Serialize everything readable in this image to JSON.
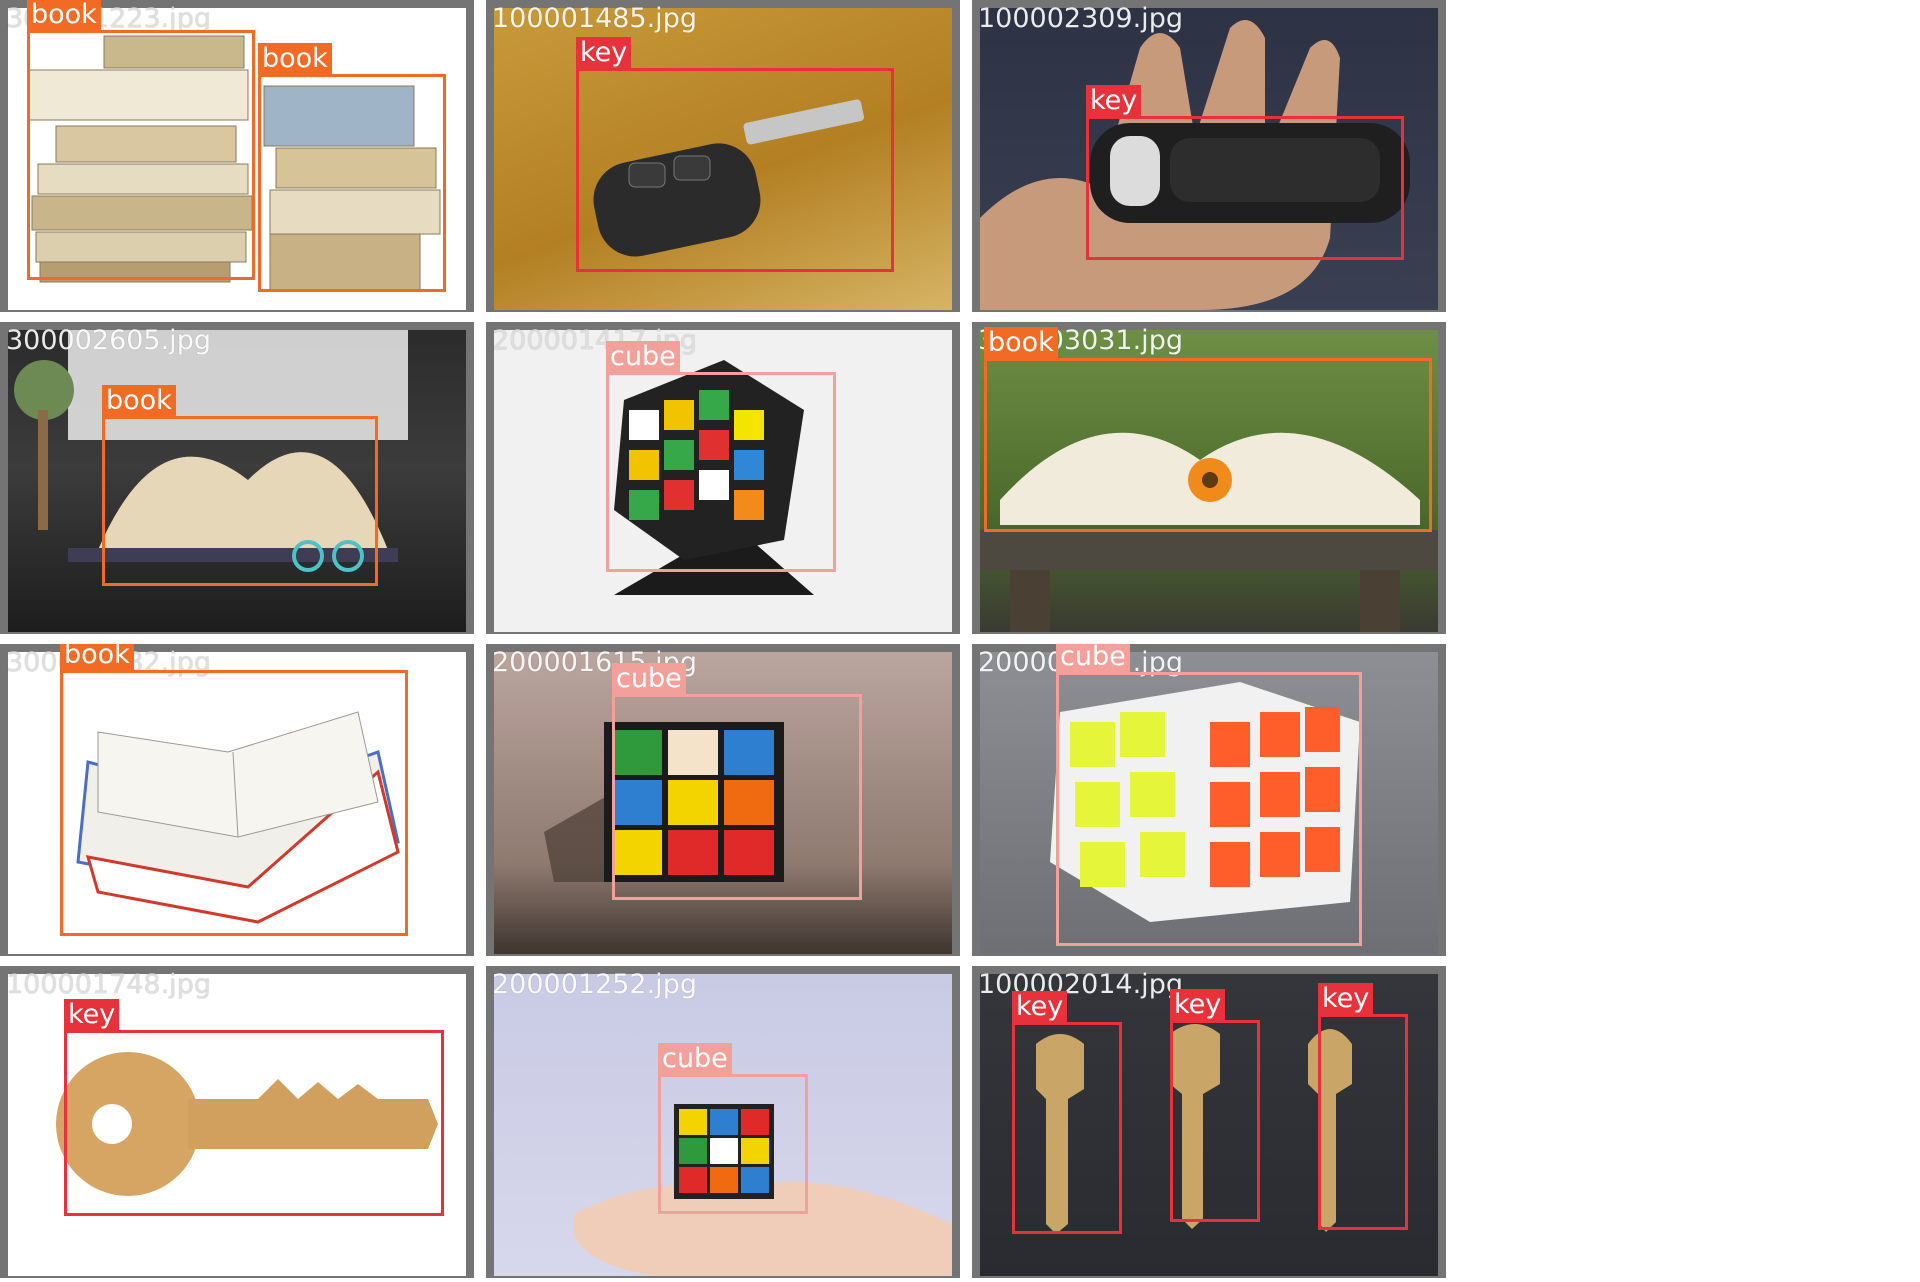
{
  "colors": {
    "book": "#f26b25",
    "key": "#e8323b",
    "cube": "#f3a09a",
    "tile_border": "#747474"
  },
  "tiles": [
    {
      "filename": "300001223.jpg",
      "boxes": [
        {
          "label": "book"
        },
        {
          "label": "book"
        }
      ]
    },
    {
      "filename": "100001485.jpg",
      "boxes": [
        {
          "label": "key"
        }
      ]
    },
    {
      "filename": "100002309.jpg",
      "boxes": [
        {
          "label": "key"
        }
      ]
    },
    {
      "filename": "300002605.jpg",
      "boxes": [
        {
          "label": "book"
        }
      ]
    },
    {
      "filename": "200001417.jpg",
      "boxes": [
        {
          "label": "cube"
        }
      ]
    },
    {
      "filename": "300003031.jpg",
      "boxes": [
        {
          "label": "book"
        }
      ]
    },
    {
      "filename": "300001382.jpg",
      "boxes": [
        {
          "label": "book"
        }
      ]
    },
    {
      "filename": "200001615.jpg",
      "boxes": [
        {
          "label": "cube"
        }
      ]
    },
    {
      "filename": "200002021.jpg",
      "boxes": [
        {
          "label": "cube"
        }
      ]
    },
    {
      "filename": "100001748.jpg",
      "boxes": [
        {
          "label": "key"
        }
      ]
    },
    {
      "filename": "200001252.jpg",
      "boxes": [
        {
          "label": "cube"
        }
      ]
    },
    {
      "filename": "100002014.jpg",
      "boxes": [
        {
          "label": "key"
        },
        {
          "label": "key"
        },
        {
          "label": "key"
        }
      ]
    }
  ]
}
